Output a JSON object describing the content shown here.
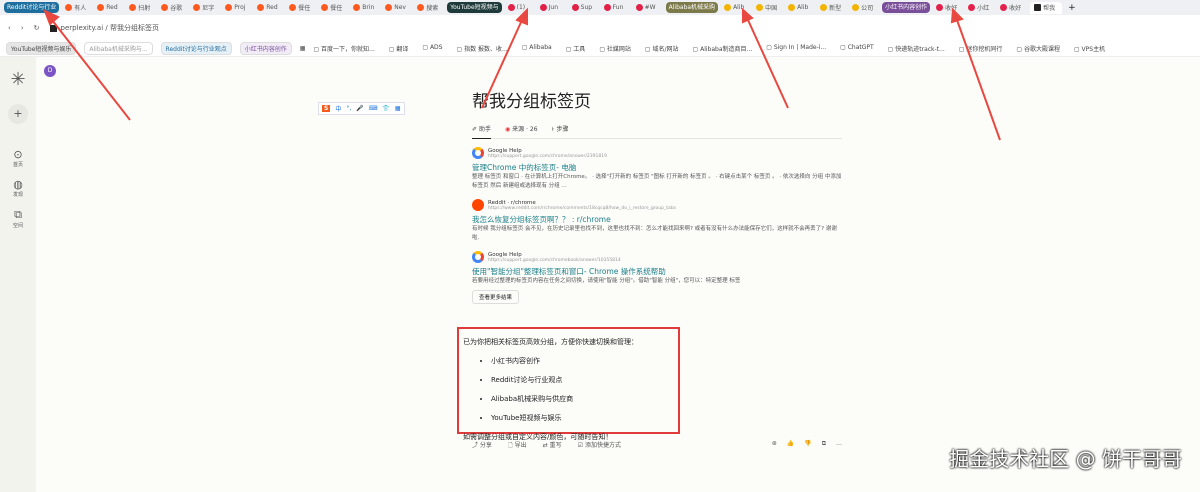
{
  "tabbar": {
    "groups": {
      "reddit": {
        "label": "Reddit讨论与行业",
        "color": "#1f6f9e"
      },
      "youtube": {
        "label": "YouTube短视频与",
        "color": "#1e3a3a"
      },
      "alibaba": {
        "label": "Alibaba机械采购",
        "color": "#7c7a4a"
      },
      "xhs": {
        "label": "小红书内容创作",
        "color": "#7a4f9a"
      }
    },
    "reddit_tabs": [
      "有人",
      "Red",
      "扫射",
      "谷歌",
      "尼字",
      "Proj",
      "Red",
      "餐任",
      "餐任",
      "Brin",
      "Nev",
      "搜索"
    ],
    "youtube_tabs": [
      "(1)",
      "Jun",
      "Sup",
      "Fun",
      "#W"
    ],
    "alibaba_tabs": [
      "Alib",
      "中国",
      "Alib",
      "新型",
      "公司"
    ],
    "xhs_tabs": [
      "收好",
      "小红",
      "收好"
    ],
    "active_tab": "帮我",
    "new_tab": "+"
  },
  "address": {
    "url": "perplexity.ai / 帮我分组标签页"
  },
  "bookmarks": {
    "chips": [
      "YouTube短视频与娱乐",
      "Alibaba机械采购与...",
      "Reddit讨论与行业观点",
      "小红书内容创作"
    ],
    "items": [
      "百度一下，你就知...",
      "翻译",
      "ADS",
      "指数 报数、收...",
      "Alibaba",
      "工具",
      "社媒网站",
      "域名/网站",
      "Alibaba制造商目...",
      "Sign In | Made-i...",
      "ChatGPT",
      "快递轨迹track-t...",
      "迷你挖机同行",
      "谷歌大殿课程",
      "VPS主机"
    ]
  },
  "sidebar": {
    "new": "+",
    "items": [
      "首页",
      "发现",
      "空间"
    ]
  },
  "avatar": "D",
  "ime": {
    "items": [
      "中",
      "°,",
      "🎤",
      "⌨",
      "👕",
      "▦"
    ]
  },
  "page": {
    "title": "帮我分组标签页",
    "tabs": {
      "assistant": "助手",
      "sources": "来源",
      "sources_count": "· 26",
      "steps": "步骤"
    },
    "results": [
      {
        "site": "Google Help",
        "url": "https://support.google.com/chrome/answer/2391819",
        "title": "管理Chrome 中的标签页- 电脑",
        "snippet": "整理 标签页 和窗口 · 在计算机上打开Chrome。 · 选择\"打开新的 标签页 \"图标 打开新的 标签页 。 · 右键点击某个 标签页 。 · 依次选择向 分组 中添加 标签页 然后 新建组或选择现有 分组 ..."
      },
      {
        "site": "Reddit · r/chrome",
        "url": "https://www.reddit.com/r/chrome/comments/18cqcq8/how_do_i_restore_group_tabs",
        "title": "我怎么恢复分组标签页啊？？ : r/chrome",
        "snippet": "有时候 我分组标签页 会不见，在历史记录里也找不到，这里也找不到：怎么才能找回来啊? 或者有没有什么办法能保存它们，这样就不会再丢了? 谢谢啦."
      },
      {
        "site": "Google Help",
        "url": "https://support.google.com/chromebook/answer/10355814",
        "title": "使用\"智能分组\"整理标签页和窗口- Chrome 操作系统帮助",
        "snippet": "若要用经过整理的标签页内容在任务之间切换，请使用\"智能 分组\"。借助\"智能 分组\"，您可以：特定整理 标签"
      }
    ],
    "more": "查看更多结果",
    "answer": {
      "intro": "已为你把相关标签页高效分组，方便你快速切换和管理：",
      "items": [
        "小红书内容创作",
        "Reddit讨论与行业观点",
        "Alibaba机械采购与供应商",
        "YouTube短视频与娱乐"
      ],
      "outro": "如需调整分组或自定义内容/颜色，可随时告知！"
    },
    "actions": {
      "share": "分享",
      "export": "导出",
      "rewrite": "重写",
      "shortcut": "添加快捷方式"
    }
  },
  "watermark": "掘金技术社区 @ 饼干哥哥"
}
